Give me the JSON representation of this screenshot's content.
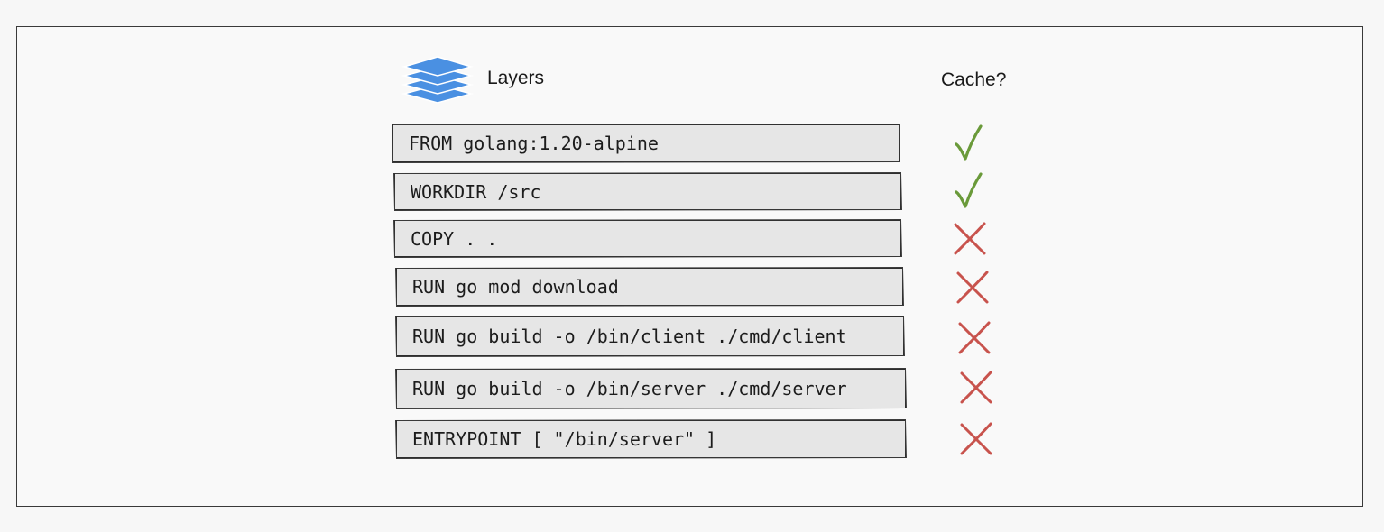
{
  "header": {
    "layers_title": "Layers",
    "cache_title": "Cache?"
  },
  "icons": {
    "layers": "layers-stack-icon",
    "cached": "checkmark-icon",
    "not_cached": "cross-icon"
  },
  "colors": {
    "layers_icon": "#4a90e2",
    "check": "#6a9a3a",
    "cross": "#c8534d",
    "box_fill": "#e6e6e6"
  },
  "layers": [
    {
      "instruction": "FROM golang:1.20-alpine",
      "cached": true
    },
    {
      "instruction": "WORKDIR /src",
      "cached": true
    },
    {
      "instruction": "COPY . .",
      "cached": false
    },
    {
      "instruction": "RUN go mod download",
      "cached": false
    },
    {
      "instruction": "RUN go build -o /bin/client ./cmd/client",
      "cached": false
    },
    {
      "instruction": "RUN go build -o /bin/server ./cmd/server",
      "cached": false
    },
    {
      "instruction": "ENTRYPOINT [ \"/bin/server\" ]",
      "cached": false
    }
  ]
}
